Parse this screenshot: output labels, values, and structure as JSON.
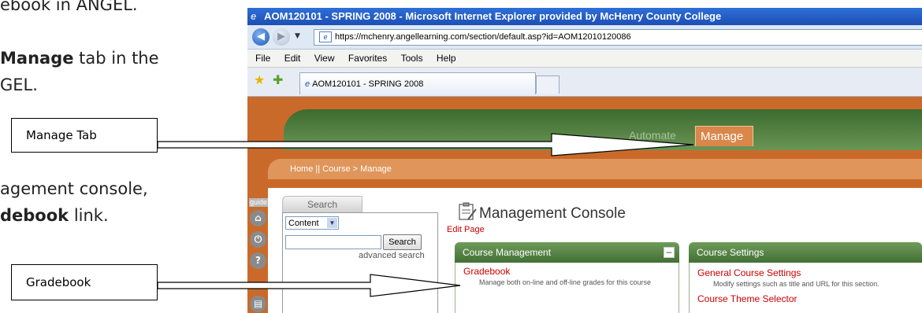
{
  "document": {
    "line1_text": "ebook in ANGEL.",
    "line2_bold": "Manage",
    "line2_text": " tab in the",
    "line3_text": "GEL.",
    "line4_text": "agement console,",
    "line5_bold": "debook",
    "line5_text": " link."
  },
  "callouts": {
    "manage_tab": "Manage Tab",
    "gradebook": "Gradebook"
  },
  "browser": {
    "window_title": "AOM120101 - SPRING 2008 - Microsoft Internet Explorer provided by McHenry County College",
    "address": "https://mchenry.angellearning.com/section/default.asp?id=AOM12010120086",
    "menu": [
      "File",
      "Edit",
      "View",
      "Favorites",
      "Tools",
      "Help"
    ],
    "tab_title": "AOM120101 - SPRING 2008"
  },
  "angel": {
    "tab_automate": "Automate",
    "tab_manage": "Manage",
    "breadcrumb": "Home || Course > Manage",
    "guide_label": "guide",
    "search_tab": "Search",
    "search_scope": "Content",
    "search_button": "Search",
    "advanced_search": "advanced search",
    "console_title": "Management Console",
    "edit_page": "Edit Page",
    "course_management": {
      "title": "Course Management",
      "gradebook_link": "Gradebook",
      "gradebook_desc": "Manage both on-line and off-line grades for this course"
    },
    "course_settings": {
      "title": "Course Settings",
      "general_link": "General Course Settings",
      "general_desc": "Modify settings such as title and URL for this section.",
      "theme_link": "Course Theme Selector"
    }
  }
}
